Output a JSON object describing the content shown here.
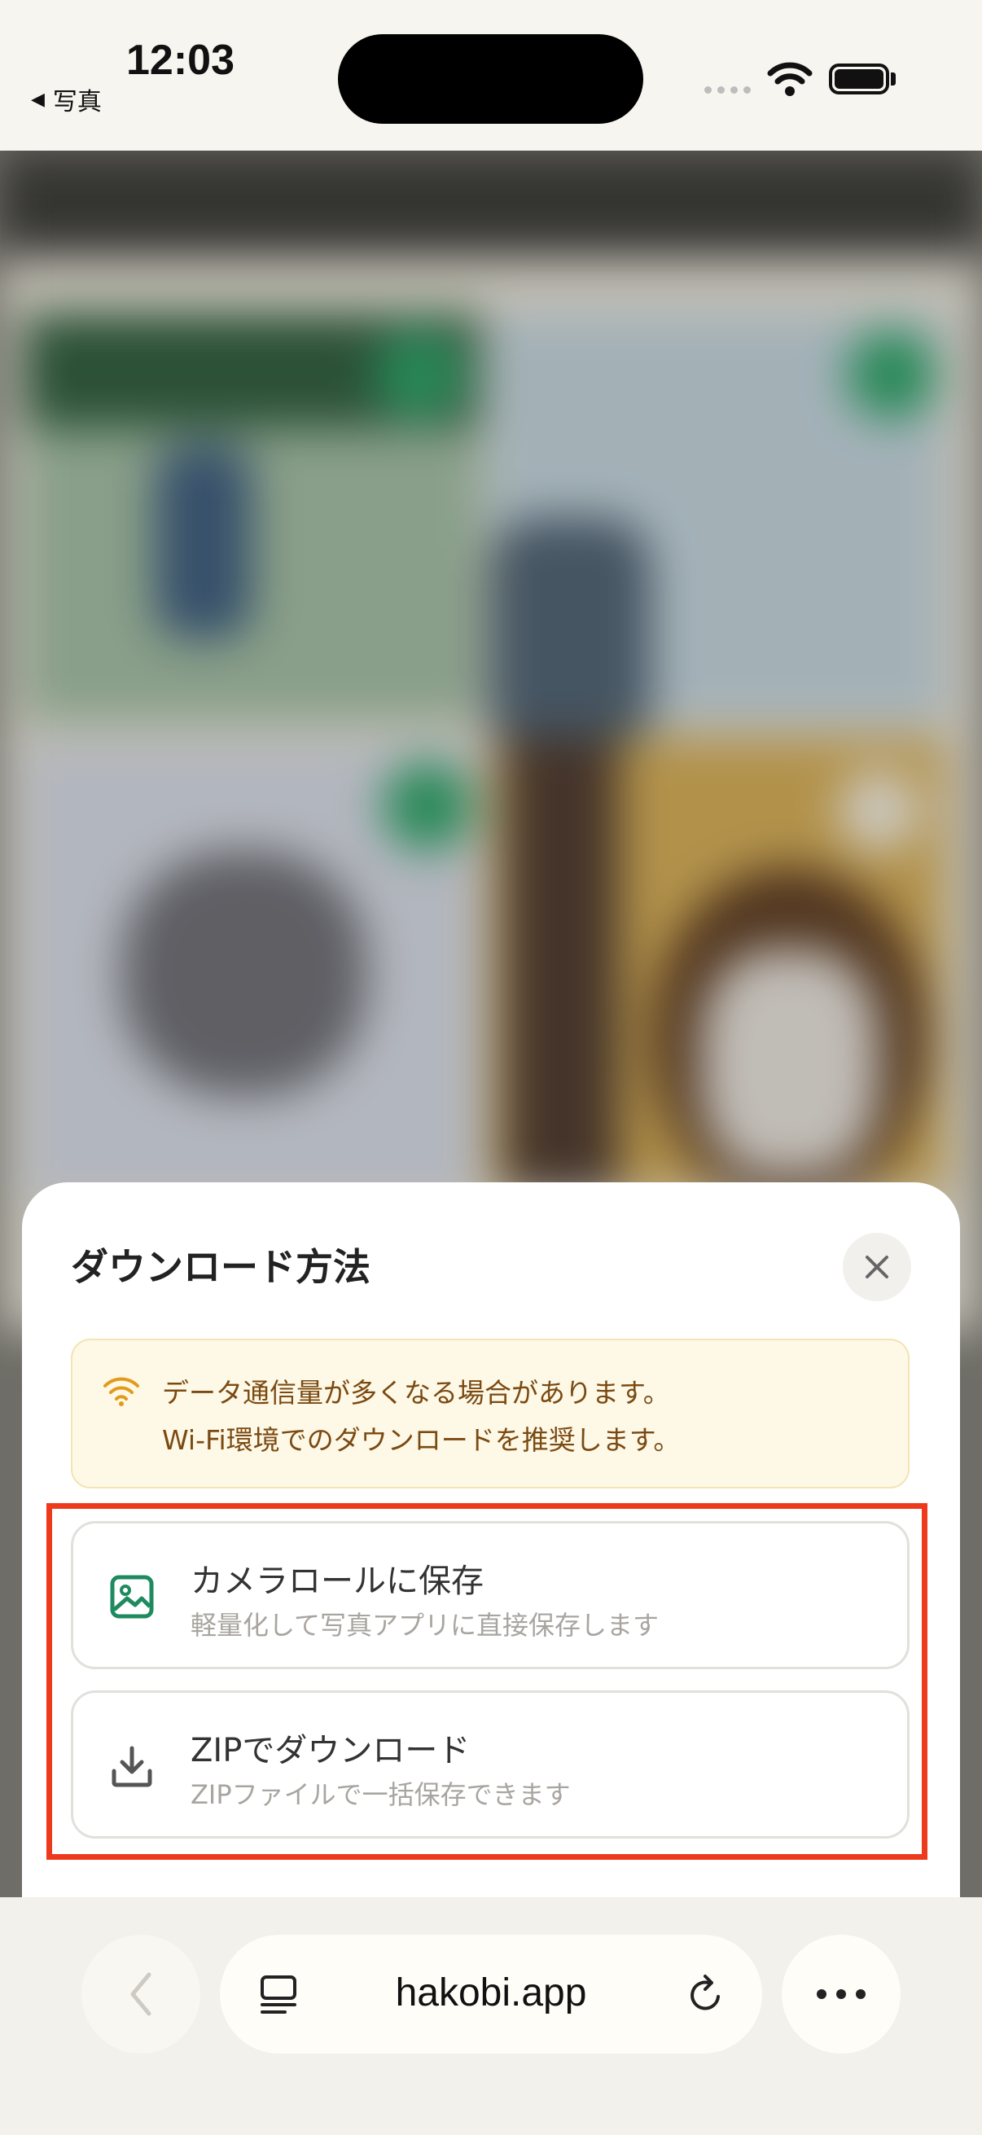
{
  "status_bar": {
    "back_label": "写真",
    "time": "12:03"
  },
  "sheet": {
    "title": "ダウンロード方法",
    "notice": {
      "line1": "データ通信量が多くなる場合があります。",
      "line2": "Wi-Fi環境でのダウンロードを推奨します。"
    },
    "options": [
      {
        "title": "カメラロールに保存",
        "subtitle": "軽量化して写真アプリに直接保存します",
        "icon": "image-icon"
      },
      {
        "title": "ZIPでダウンロード",
        "subtitle": "ZIPファイルで一括保存できます",
        "icon": "download-icon"
      }
    ]
  },
  "browser": {
    "url": "hakobi.app"
  },
  "colors": {
    "accent_green": "#1e8a5f",
    "notice_text": "#7a4a12",
    "notice_bg": "#fef8e6",
    "highlight": "#ee3a1c"
  }
}
